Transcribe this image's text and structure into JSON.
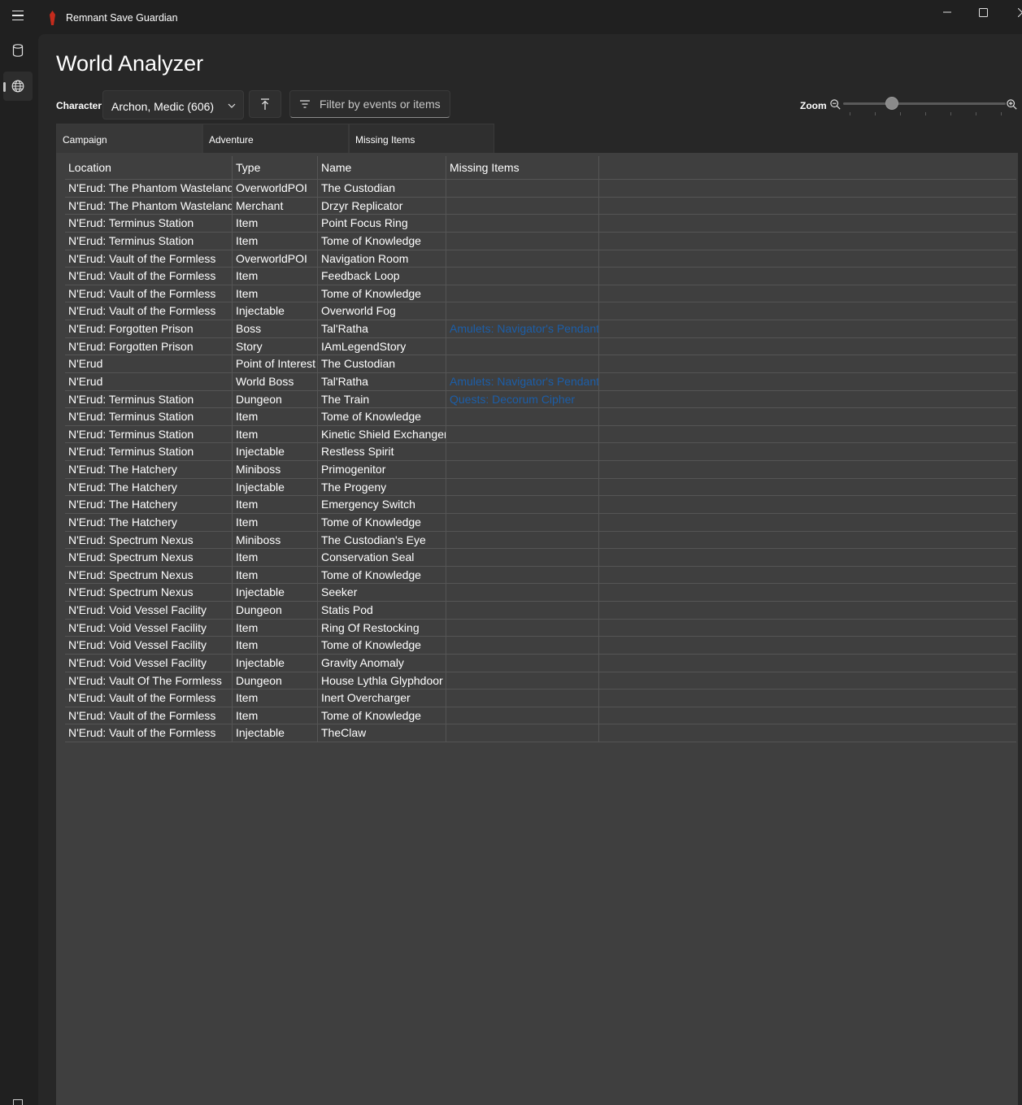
{
  "app": {
    "title": "Remnant Save Guardian",
    "accent_color": "#c42b1c"
  },
  "nav": {
    "items": [
      {
        "icon": "database-icon",
        "active": false
      },
      {
        "icon": "globe-icon",
        "active": true
      }
    ]
  },
  "page": {
    "title": "World Analyzer"
  },
  "toolbar": {
    "character_label": "Character",
    "character_value": "Archon, Medic (606)",
    "filter_placeholder": "Filter by events or items",
    "zoom_label": "Zoom",
    "zoom_level": 0.3
  },
  "tabs": [
    {
      "label": "Campaign",
      "active": true
    },
    {
      "label": "Adventure",
      "active": false
    },
    {
      "label": "Missing Items",
      "active": false
    }
  ],
  "grid": {
    "columns": [
      "Location",
      "Type",
      "Name",
      "Missing Items"
    ],
    "link_color": "#1c5ea8",
    "rows": [
      {
        "location": "N'Erud: The Phantom Wasteland",
        "type": "OverworldPOI",
        "name": "The Custodian",
        "missing": ""
      },
      {
        "location": "N'Erud: The Phantom Wasteland",
        "type": "Merchant",
        "name": "Drzyr Replicator",
        "missing": ""
      },
      {
        "location": "N'Erud: Terminus Station",
        "type": "Item",
        "name": "Point Focus Ring",
        "missing": ""
      },
      {
        "location": "N'Erud: Terminus Station",
        "type": "Item",
        "name": "Tome of Knowledge",
        "missing": ""
      },
      {
        "location": "N'Erud: Vault of the Formless",
        "type": "OverworldPOI",
        "name": "Navigation Room",
        "missing": ""
      },
      {
        "location": "N'Erud: Vault of the Formless",
        "type": "Item",
        "name": "Feedback Loop",
        "missing": ""
      },
      {
        "location": "N'Erud: Vault of the Formless",
        "type": "Item",
        "name": "Tome of Knowledge",
        "missing": ""
      },
      {
        "location": "N'Erud: Vault of the Formless",
        "type": "Injectable",
        "name": "Overworld Fog",
        "missing": ""
      },
      {
        "location": "N'Erud: Forgotten Prison",
        "type": "Boss",
        "name": "Tal'Ratha",
        "missing": "Amulets: Navigator's Pendant"
      },
      {
        "location": "N'Erud: Forgotten Prison",
        "type": "Story",
        "name": "IAmLegendStory",
        "missing": ""
      },
      {
        "location": "N'Erud",
        "type": "Point of Interest",
        "name": "The Custodian",
        "missing": ""
      },
      {
        "location": "N'Erud",
        "type": "World Boss",
        "name": "Tal'Ratha",
        "missing": "Amulets: Navigator's Pendant"
      },
      {
        "location": "N'Erud: Terminus Station",
        "type": "Dungeon",
        "name": "The Train",
        "missing": "Quests: Decorum Cipher"
      },
      {
        "location": "N'Erud: Terminus Station",
        "type": "Item",
        "name": "Tome of Knowledge",
        "missing": ""
      },
      {
        "location": "N'Erud: Terminus Station",
        "type": "Item",
        "name": "Kinetic Shield Exchanger",
        "missing": ""
      },
      {
        "location": "N'Erud: Terminus Station",
        "type": "Injectable",
        "name": "Restless Spirit",
        "missing": ""
      },
      {
        "location": "N'Erud: The Hatchery",
        "type": "Miniboss",
        "name": "Primogenitor",
        "missing": ""
      },
      {
        "location": "N'Erud: The Hatchery",
        "type": "Injectable",
        "name": "The Progeny",
        "missing": ""
      },
      {
        "location": "N'Erud: The Hatchery",
        "type": "Item",
        "name": "Emergency Switch",
        "missing": ""
      },
      {
        "location": "N'Erud: The Hatchery",
        "type": "Item",
        "name": "Tome of Knowledge",
        "missing": ""
      },
      {
        "location": "N'Erud: Spectrum Nexus",
        "type": "Miniboss",
        "name": "The Custodian's Eye",
        "missing": ""
      },
      {
        "location": "N'Erud: Spectrum Nexus",
        "type": "Item",
        "name": "Conservation Seal",
        "missing": ""
      },
      {
        "location": "N'Erud: Spectrum Nexus",
        "type": "Item",
        "name": "Tome of Knowledge",
        "missing": ""
      },
      {
        "location": "N'Erud: Spectrum Nexus",
        "type": "Injectable",
        "name": "Seeker",
        "missing": ""
      },
      {
        "location": "N'Erud: Void Vessel Facility",
        "type": "Dungeon",
        "name": "Statis Pod",
        "missing": ""
      },
      {
        "location": "N'Erud: Void Vessel Facility",
        "type": "Item",
        "name": "Ring Of Restocking",
        "missing": ""
      },
      {
        "location": "N'Erud: Void Vessel Facility",
        "type": "Item",
        "name": "Tome of Knowledge",
        "missing": ""
      },
      {
        "location": "N'Erud: Void Vessel Facility",
        "type": "Injectable",
        "name": "Gravity Anomaly",
        "missing": ""
      },
      {
        "location": "N'Erud: Vault Of The Formless",
        "type": "Dungeon",
        "name": "House Lythla Glyphdoor",
        "missing": ""
      },
      {
        "location": "N'Erud: Vault of the Formless",
        "type": "Item",
        "name": "Inert Overcharger",
        "missing": ""
      },
      {
        "location": "N'Erud: Vault of the Formless",
        "type": "Item",
        "name": "Tome of Knowledge",
        "missing": ""
      },
      {
        "location": "N'Erud: Vault of the Formless",
        "type": "Injectable",
        "name": "TheClaw",
        "missing": ""
      }
    ]
  }
}
